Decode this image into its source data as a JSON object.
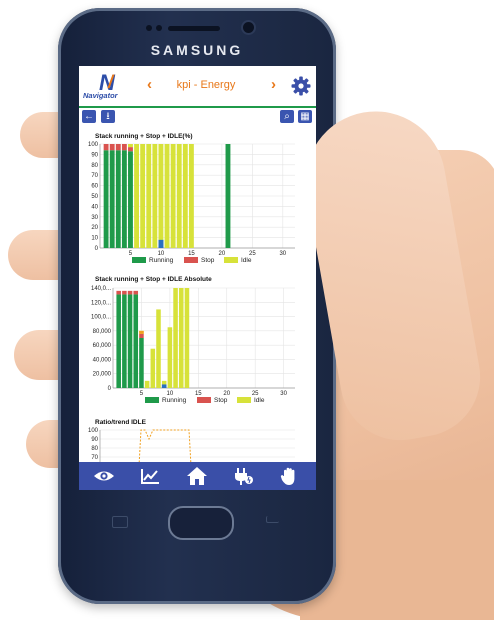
{
  "device": {
    "brand": "SAMSUNG"
  },
  "app": {
    "logo_text": "Navigator",
    "title": "kpi - Energy",
    "prev_icon": "chevron-left-icon",
    "next_icon": "chevron-right-icon"
  },
  "colors": {
    "running": "#1f9a4a",
    "stop": "#d9534f",
    "idle": "#d7e23a",
    "blue": "#2a6fc0",
    "orange": "#f0a020",
    "accent": "#e8781a",
    "nav": "#3a4fa8"
  },
  "legend": {
    "running": "Running",
    "stop": "Stop",
    "idle": "Idle"
  },
  "chart_data": [
    {
      "type": "bar",
      "title": "Stack running + Stop + IDLE(%)",
      "ylim": [
        0,
        100
      ],
      "yticks": [
        "0",
        "10",
        "20",
        "30",
        "40",
        "50",
        "60",
        "70",
        "80",
        "90",
        "100"
      ],
      "xticks": [
        "5",
        "10",
        "15",
        "20",
        "25",
        "30"
      ],
      "x": [
        1,
        2,
        3,
        4,
        5,
        6,
        7,
        8,
        9,
        10,
        11,
        12,
        13,
        14,
        15,
        21
      ],
      "series": [
        {
          "name": "Running",
          "values": [
            94,
            94,
            94,
            94,
            93,
            0,
            0,
            0,
            0,
            8,
            0,
            0,
            0,
            0,
            0,
            100
          ]
        },
        {
          "name": "Stop",
          "values": [
            6,
            6,
            6,
            6,
            4,
            0,
            0,
            0,
            0,
            0,
            0,
            0,
            0,
            0,
            0,
            0
          ]
        },
        {
          "name": "Idle",
          "values": [
            0,
            0,
            0,
            0,
            3,
            100,
            100,
            100,
            100,
            92,
            100,
            100,
            100,
            100,
            100,
            0
          ]
        }
      ]
    },
    {
      "type": "bar",
      "title": "Stack running + Stop + IDLE Absolute",
      "ylim": [
        0,
        140000
      ],
      "yticks": [
        "0",
        "20,000",
        "40,000",
        "60,000",
        "80,000",
        "100,0...",
        "120,0...",
        "140,0..."
      ],
      "xticks": [
        "5",
        "10",
        "15",
        "20",
        "25",
        "30"
      ],
      "x": [
        1,
        2,
        3,
        4,
        5,
        6,
        7,
        8,
        9,
        10,
        11,
        12,
        13,
        14,
        15
      ],
      "series": [
        {
          "name": "Running",
          "values": [
            131000,
            131000,
            131000,
            131000,
            70000,
            0,
            0,
            0,
            5000,
            0,
            0,
            0,
            0,
            0,
            0
          ]
        },
        {
          "name": "Stop",
          "values": [
            5000,
            5000,
            5000,
            5000,
            6000,
            0,
            0,
            0,
            0,
            0,
            0,
            0,
            0,
            0,
            0
          ]
        },
        {
          "name": "Idle",
          "values": [
            0,
            0,
            0,
            0,
            4000,
            10000,
            55000,
            110000,
            5000,
            85000,
            140000,
            140000,
            140000,
            0,
            0
          ]
        }
      ]
    },
    {
      "type": "line",
      "title": "Ratio/trend IDLE",
      "ylim": [
        70,
        100
      ],
      "yticks": [
        "70",
        "80",
        "90",
        "100"
      ]
    }
  ],
  "nav": [
    "eye-icon",
    "trend-icon",
    "home-icon",
    "plug-icon",
    "hand-stop-icon"
  ]
}
